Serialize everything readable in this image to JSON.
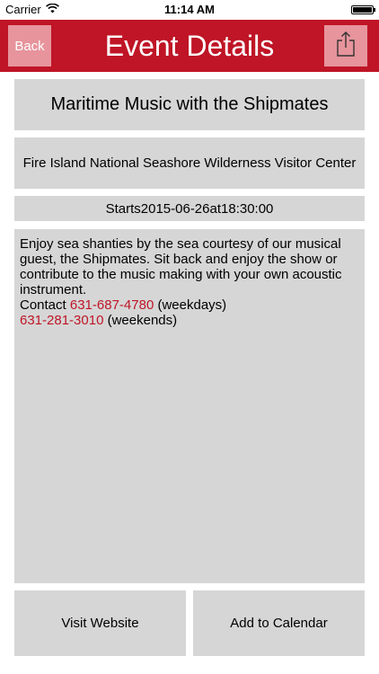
{
  "status_bar": {
    "carrier": "Carrier",
    "time": "11:14 AM",
    "battery_level": 1.0
  },
  "navbar": {
    "back_label": "Back",
    "title": "Event Details",
    "share_icon": "share-icon",
    "background_color": "#bf1526",
    "button_color": "#e7949c"
  },
  "event": {
    "title": "Maritime Music with the Shipmates",
    "location": "Fire Island National Seashore Wilderness Visitor Center",
    "start_prefix": "Starts ",
    "start_date": "2015-06-26",
    "start_at": " at ",
    "start_time": "18:30:00",
    "description": "Enjoy sea shanties by the sea courtesy of our musical guest, the Shipmates. Sit back and enjoy the show or contribute to the music making with your own acoustic instrument.",
    "contact_prefix": "Contact ",
    "phone_weekdays": "631-687-4780",
    "weekdays_label": " (weekdays)",
    "phone_weekends": "631-281-3010",
    "weekends_label": " (weekends)",
    "link_color": "#bf1526"
  },
  "actions": {
    "visit_website": "Visit Website",
    "add_to_calendar": "Add to Calendar"
  }
}
